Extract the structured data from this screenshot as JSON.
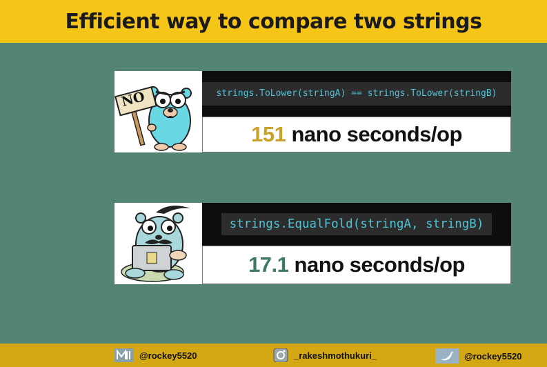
{
  "header": {
    "title": "Efficient way to compare two strings"
  },
  "comparisons": [
    {
      "mascot": {
        "sign_text": "NO"
      },
      "code": "strings.ToLower(stringA) == strings.ToLower(stringB)",
      "result_value": "151",
      "result_unit": " nano seconds/op",
      "value_color": "#c9a227"
    },
    {
      "code": "strings.EqualFold(stringA, stringB)",
      "result_value": "17.1",
      "result_unit": " nano seconds/op",
      "value_color": "#3e7a6a"
    }
  ],
  "footer": {
    "social": [
      {
        "icon": "medium-icon",
        "handle": "@rockey5520"
      },
      {
        "icon": "instagram-icon",
        "handle": "_rakeshmothukuri_"
      },
      {
        "icon": "twitter-icon",
        "handle": "@rockey5520"
      }
    ]
  },
  "colors": {
    "background": "#548476",
    "title_bar": "#f5c518",
    "footer": "#d4a815",
    "code_text": "#4fc3d6"
  }
}
